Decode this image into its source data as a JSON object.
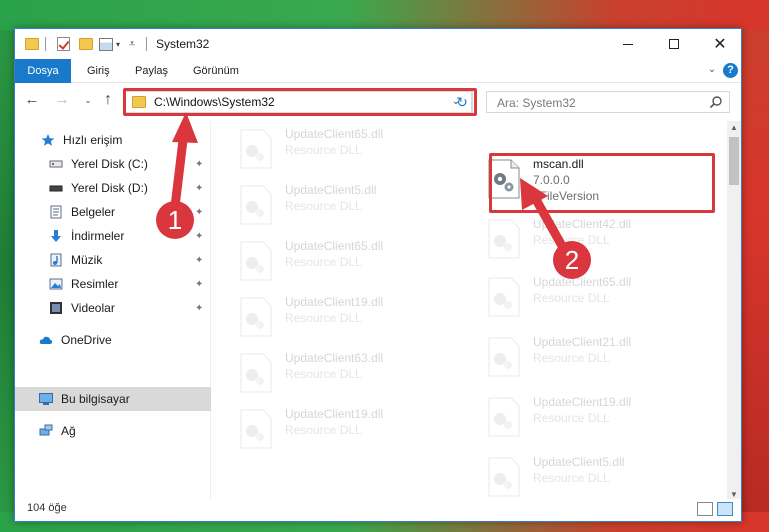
{
  "window": {
    "title": "System32",
    "min_label": "",
    "max_label": "",
    "close_label": "✕"
  },
  "ribbon": {
    "tabs": [
      "Dosya",
      "Giriş",
      "Paylaş",
      "Görünüm"
    ],
    "expand_glyph": "⌄",
    "help_label": "?"
  },
  "navigation": {
    "back_glyph": "←",
    "forward_glyph": "→",
    "recent_glyph": "⌄",
    "up_glyph": "↑",
    "address": "C:\\Windows\\System32",
    "address_dropdown_glyph": "⌄",
    "refresh_glyph": "↻",
    "search_placeholder": "Ara: System32"
  },
  "sidebar": {
    "items": [
      {
        "label": "Hızlı erişim",
        "icon": "star-icon",
        "pinned": false
      },
      {
        "label": "Yerel Disk (C:)",
        "icon": "drive-icon",
        "pinned": true
      },
      {
        "label": "Yerel Disk (D:)",
        "icon": "drive-icon",
        "pinned": true
      },
      {
        "label": "Belgeler",
        "icon": "documents-icon",
        "pinned": true
      },
      {
        "label": "İndirmeler",
        "icon": "download-icon",
        "pinned": true
      },
      {
        "label": "Müzik",
        "icon": "music-icon",
        "pinned": true
      },
      {
        "label": "Resimler",
        "icon": "pictures-icon",
        "pinned": true
      },
      {
        "label": "Videolar",
        "icon": "videos-icon",
        "pinned": true
      },
      {
        "label": "OneDrive",
        "icon": "cloud-icon",
        "pinned": false
      },
      {
        "label": "Bu bilgisayar",
        "icon": "computer-icon",
        "pinned": false,
        "selected": true
      },
      {
        "label": "Ağ",
        "icon": "network-icon",
        "pinned": false
      }
    ],
    "pin_glyph": "📌"
  },
  "files": {
    "highlighted": {
      "name": "mscan.dll",
      "version": "7.0.0.0",
      "description": "0FileVersion"
    },
    "left_column": [
      {
        "name": "UpdateClient65.dll",
        "type": "Resource DLL"
      },
      {
        "name": "UpdateClient5.dll",
        "type": "Resource DLL"
      },
      {
        "name": "UpdateClient65.dll",
        "type": "Resource DLL"
      },
      {
        "name": "UpdateClient19.dll",
        "type": "Resource DLL"
      },
      {
        "name": "UpdateClient63.dll",
        "type": "Resource DLL"
      },
      {
        "name": "UpdateClient19.dll",
        "type": "Resource DLL"
      }
    ],
    "right_column": [
      {
        "name": "UpdateClient42.dll",
        "type": "Resource DLL"
      },
      {
        "name": "UpdateClient65.dll",
        "type": "Resource DLL"
      },
      {
        "name": "UpdateClient21.dll",
        "type": "Resource DLL"
      },
      {
        "name": "UpdateClient19.dll",
        "type": "Resource DLL"
      },
      {
        "name": "UpdateClient5.dll",
        "type": "Resource DLL"
      }
    ]
  },
  "status": {
    "item_count": "104 öğe"
  },
  "annotations": {
    "step1": "1",
    "step2": "2",
    "color": "#d9363e"
  }
}
